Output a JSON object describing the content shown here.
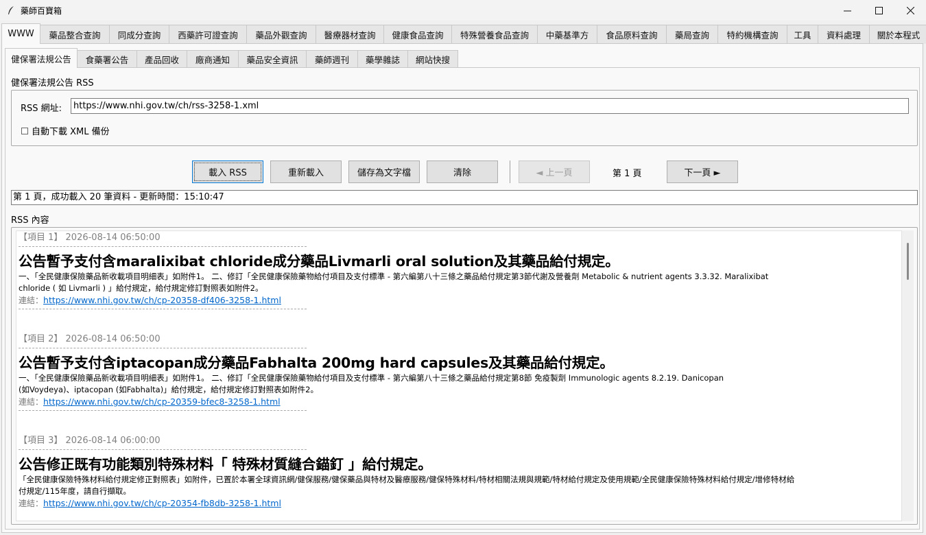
{
  "window": {
    "title": "藥師百寶箱",
    "minimize": "—",
    "maximize": "☐",
    "close": "✕"
  },
  "main_tabs": [
    {
      "label": "WWW",
      "active": true
    },
    {
      "label": "藥品整合查詢"
    },
    {
      "label": "同成分查詢"
    },
    {
      "label": "西藥許可證查詢"
    },
    {
      "label": "藥品外觀查詢"
    },
    {
      "label": "醫療器材查詢"
    },
    {
      "label": "健康食品查詢"
    },
    {
      "label": "特殊營養食品查詢"
    },
    {
      "label": "中藥基準方"
    },
    {
      "label": "食品原料查詢"
    },
    {
      "label": "藥局查詢"
    },
    {
      "label": "特約機構查詢"
    },
    {
      "label": "工具"
    },
    {
      "label": "資料處理"
    },
    {
      "label": "關於本程式"
    }
  ],
  "sub_tabs": [
    {
      "label": "健保署法規公告",
      "active": true
    },
    {
      "label": "食藥署公告"
    },
    {
      "label": "產品回收"
    },
    {
      "label": "廠商通知"
    },
    {
      "label": "藥品安全資訊"
    },
    {
      "label": "藥師週刊"
    },
    {
      "label": "藥學雜誌"
    },
    {
      "label": "網站快搜"
    }
  ],
  "rss_section": {
    "title": "健保署法規公告 RSS",
    "url_label": "RSS 網址:",
    "url_value": "https://www.nhi.gov.tw/ch/rss-3258-1.xml",
    "auto_download_label": "自動下載 XML 備份",
    "auto_download_checked": false
  },
  "toolbar": {
    "load": "載入 RSS",
    "reload": "重新載入",
    "save": "儲存為文字檔",
    "clear": "清除",
    "prev": "◄ 上一頁",
    "page": "第 1 頁",
    "next": "下一頁 ►"
  },
  "status": "第 1 頁，成功載入 20 筆資料 - 更新時間：15:10:47",
  "content_label": "RSS 內容",
  "items": [
    {
      "meta": "【項目 1】 2026-08-14 06:50:00",
      "title": "公告暫予支付含maralixibat chloride成分藥品Livmarli oral solution及其藥品給付規定。",
      "desc1": "一、「全民健康保險藥品新收載項目明細表」如附件1。 二、修訂「全民健康保險藥物給付項目及支付標準 - 第六編第八十三條之藥品給付規定第3節代謝及營養劑 Metabolic & nutrient agents 3.3.32. Maralixibat",
      "desc2": "chloride ( 如 Livmarli ) 」給付規定，給付規定修訂對照表如附件2。",
      "link_label": "連結：",
      "link": "https://www.nhi.gov.tw/ch/cp-20358-df406-3258-1.html"
    },
    {
      "meta": "【項目 2】 2026-08-14 06:50:00",
      "title": "公告暫予支付含iptacopan成分藥品Fabhalta 200mg hard capsules及其藥品給付規定。",
      "desc1": "一、「全民健康保險藥品新收載項目明細表」如附件1。 二、修訂「全民健康保險藥物給付項目及支付標準 - 第六編第八十三條之藥品給付規定第8節 免疫製劑 Immunologic agents 8.2.19. Danicopan",
      "desc2": "(如Voydeya)、iptacopan (如Fabhalta)」給付規定，給付規定修訂對照表如附件2。",
      "link_label": "連結：",
      "link": "https://www.nhi.gov.tw/ch/cp-20359-bfec8-3258-1.html"
    },
    {
      "meta": "【項目 3】 2026-08-14 06:00:00",
      "title": "公告修正既有功能類別特殊材料「 特殊材質縫合錨釘 」給付規定。",
      "desc1": "「全民健康保險特殊材料給付規定修正對照表」如附件，已置於本署全球資訊網/健保服務/健保藥品與特材及醫療服務/健保特殊材料/特材相關法規與規範/特材給付規定及使用規範/全民健康保險特殊材料給付規定/增修特材給",
      "desc2": "付規定/115年度，請自行擷取。",
      "link_label": "連結：",
      "link": "https://www.nhi.gov.tw/ch/cp-20354-fb8db-3258-1.html"
    }
  ]
}
